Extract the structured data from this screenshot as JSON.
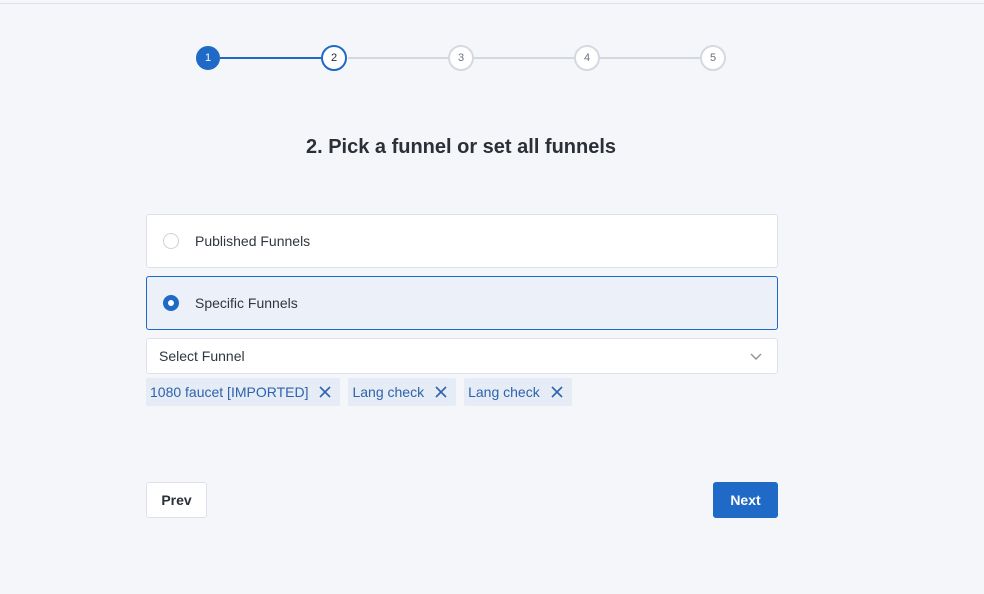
{
  "stepper": {
    "steps": [
      {
        "label": "1",
        "state": "complete"
      },
      {
        "label": "2",
        "state": "current"
      },
      {
        "label": "3",
        "state": "upcoming"
      },
      {
        "label": "4",
        "state": "upcoming"
      },
      {
        "label": "5",
        "state": "upcoming"
      }
    ]
  },
  "title": "2. Pick a funnel or set all funnels",
  "options": [
    {
      "label": "Published Funnels",
      "selected": false
    },
    {
      "label": "Specific Funnels",
      "selected": true
    }
  ],
  "select": {
    "placeholder": "Select Funnel",
    "icon": "chevron-down-icon"
  },
  "tags": [
    {
      "label": "1080 faucet [IMPORTED]"
    },
    {
      "label": "Lang check"
    },
    {
      "label": "Lang check"
    }
  ],
  "buttons": {
    "prev": "Prev",
    "next": "Next"
  },
  "colors": {
    "accent": "#1e6ac6",
    "background": "#f4f6fa",
    "tag_bg": "#e6ecf5",
    "tag_text": "#2e62ad"
  }
}
